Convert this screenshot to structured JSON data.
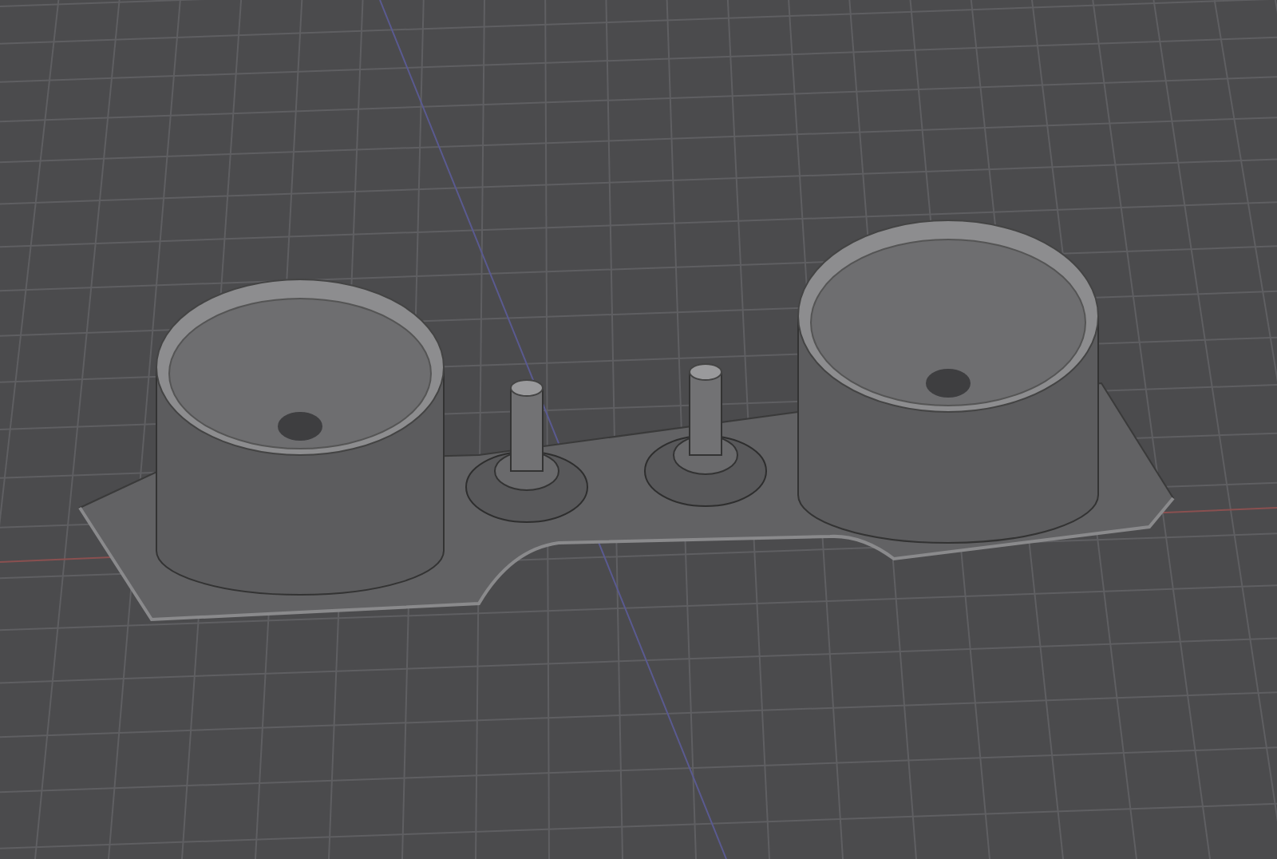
{
  "viewport": {
    "grid": true,
    "model": true
  }
}
